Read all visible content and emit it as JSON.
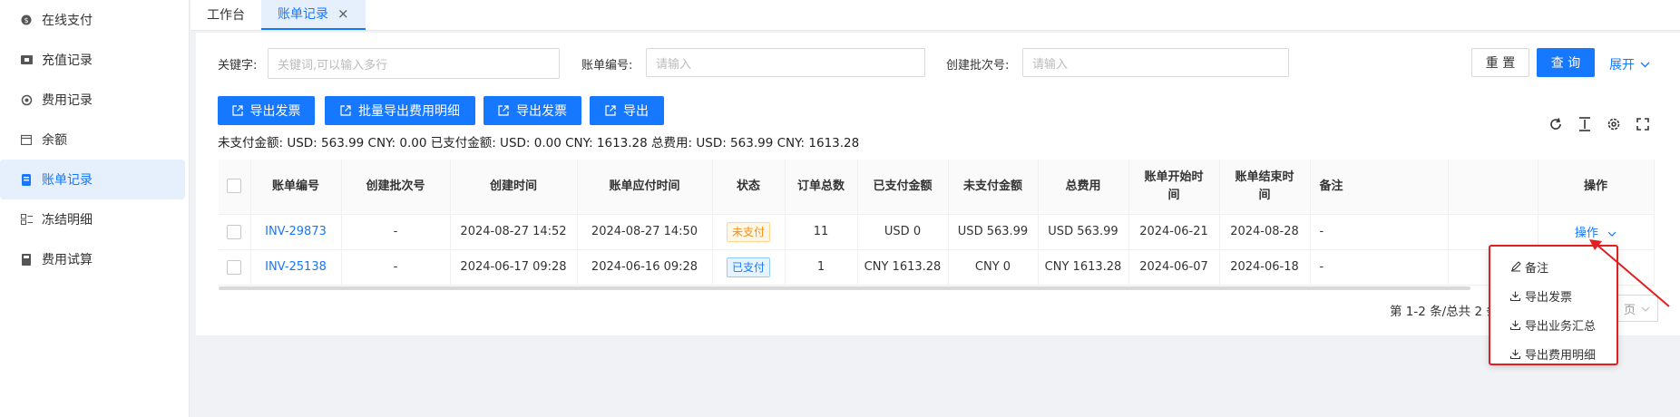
{
  "sidebar": {
    "items": [
      {
        "label": "在线支付",
        "icon": "coin-icon"
      },
      {
        "label": "充值记录",
        "icon": "ticket-icon"
      },
      {
        "label": "费用记录",
        "icon": "refresh-coin-icon"
      },
      {
        "label": "余额",
        "icon": "calendar-icon"
      },
      {
        "label": "账单记录",
        "icon": "bill-icon",
        "active": true
      },
      {
        "label": "冻结明细",
        "icon": "list-icon"
      },
      {
        "label": "费用试算",
        "icon": "calculator-icon"
      }
    ]
  },
  "tabs": [
    {
      "label": "工作台"
    },
    {
      "label": "账单记录",
      "close": "×",
      "active": true
    }
  ],
  "filters": {
    "keyword": {
      "label": "关键字:",
      "placeholder": "关键词,可以输入多行"
    },
    "bill_no": {
      "label": "账单编号:",
      "placeholder": "请输入"
    },
    "batch_no": {
      "label": "创建批次号:",
      "placeholder": "请输入"
    },
    "reset_label": "重 置",
    "search_label": "查 询",
    "expand_label": "展开"
  },
  "actions": {
    "export_invoice_1": "导出发票",
    "batch_export": "批量导出费用明细",
    "export_invoice_2": "导出发票",
    "export": "导出"
  },
  "summary": "未支付金额: USD: 563.99 CNY: 0.00  已支付金额: USD: 0.00 CNY: 1613.28  总费用: USD: 563.99 CNY: 1613.28",
  "table": {
    "headers": {
      "bill_no": "账单编号",
      "batch_no": "创建批次号",
      "created": "创建时间",
      "due": "账单应付时间",
      "status": "状态",
      "orders": "订单总数",
      "paid": "已支付金额",
      "unpaid": "未支付金额",
      "total": "总费用",
      "start_l1": "账单开始时",
      "start_l2": "间",
      "end_l1": "账单结束时",
      "end_l2": "间",
      "remark": "备注",
      "op": "操作"
    },
    "rows": [
      {
        "bill_no": "INV-29873",
        "batch_no": "-",
        "created": "2024-08-27 14:52",
        "due": "2024-08-27 14:50",
        "status": "未支付",
        "orders": "11",
        "paid": "USD 0",
        "unpaid": "USD 563.99",
        "total": "USD 563.99",
        "start": "2024-06-21",
        "end": "2024-08-28",
        "remark": "-",
        "op": "操作"
      },
      {
        "bill_no": "INV-25138",
        "batch_no": "-",
        "created": "2024-06-17 09:28",
        "due": "2024-06-16 09:28",
        "status": "已支付",
        "orders": "1",
        "paid": "CNY 1613.28",
        "unpaid": "CNY 0",
        "total": "CNY 1613.28",
        "start": "2024-06-07",
        "end": "2024-06-18",
        "remark": "-",
        "op": ""
      }
    ]
  },
  "pagination": {
    "text": "第 1-2 条/总共 2 条",
    "size_suffix": "页"
  },
  "dropdown": {
    "items": [
      "备注",
      "导出发票",
      "导出业务汇总",
      "导出费用明细"
    ]
  },
  "colors": {
    "primary": "#1677ff",
    "highlight": "#e02020"
  }
}
